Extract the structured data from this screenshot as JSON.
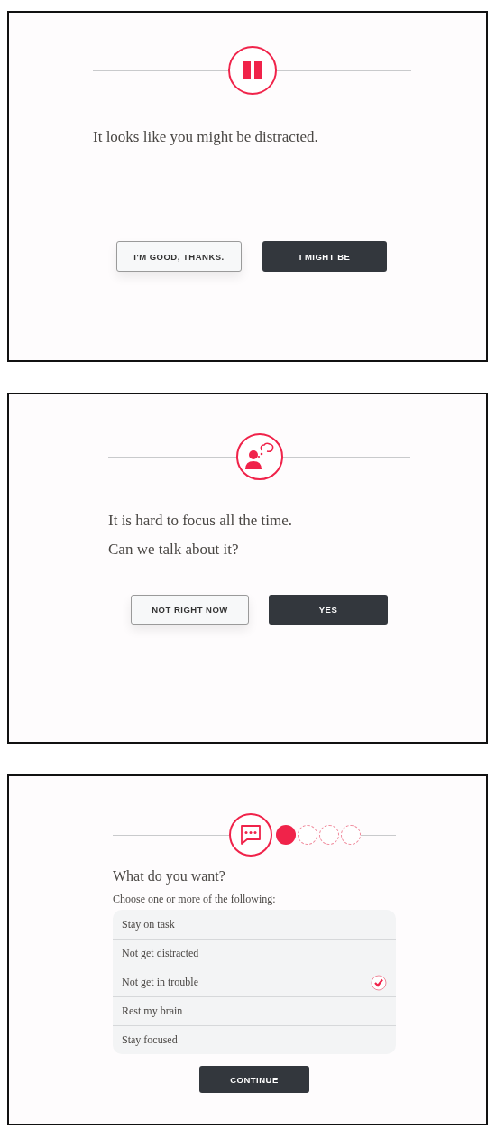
{
  "screens": [
    {
      "kind": "prompt",
      "lines": [
        "It looks like you might be distracted."
      ],
      "buttons": [
        {
          "label": "I'M GOOD, THANKS.",
          "kind": "secondary"
        },
        {
          "label": "I MIGHT BE",
          "kind": "primary"
        }
      ]
    },
    {
      "kind": "prompt",
      "lines": [
        "It is hard to focus all the time.",
        "Can we talk about it?"
      ],
      "buttons": [
        {
          "label": "NOT RIGHT NOW",
          "kind": "secondary"
        },
        {
          "label": "YES",
          "kind": "primary"
        }
      ]
    },
    {
      "kind": "survey",
      "steps": [
        {
          "done": true
        },
        {
          "done": false
        },
        {
          "done": false
        },
        {
          "done": false
        }
      ],
      "question": "What do you want?",
      "instruction": "Choose one or more of the following:",
      "options": [
        {
          "label": "Stay on task",
          "checked": false
        },
        {
          "label": "Not get distracted",
          "checked": false
        },
        {
          "label": "Not get in trouble",
          "checked": true
        },
        {
          "label": "Rest my brain",
          "checked": false
        },
        {
          "label": "Stay focused",
          "checked": false
        }
      ],
      "buttons": [
        {
          "label": "CONTINUE",
          "kind": "primary"
        }
      ]
    }
  ]
}
